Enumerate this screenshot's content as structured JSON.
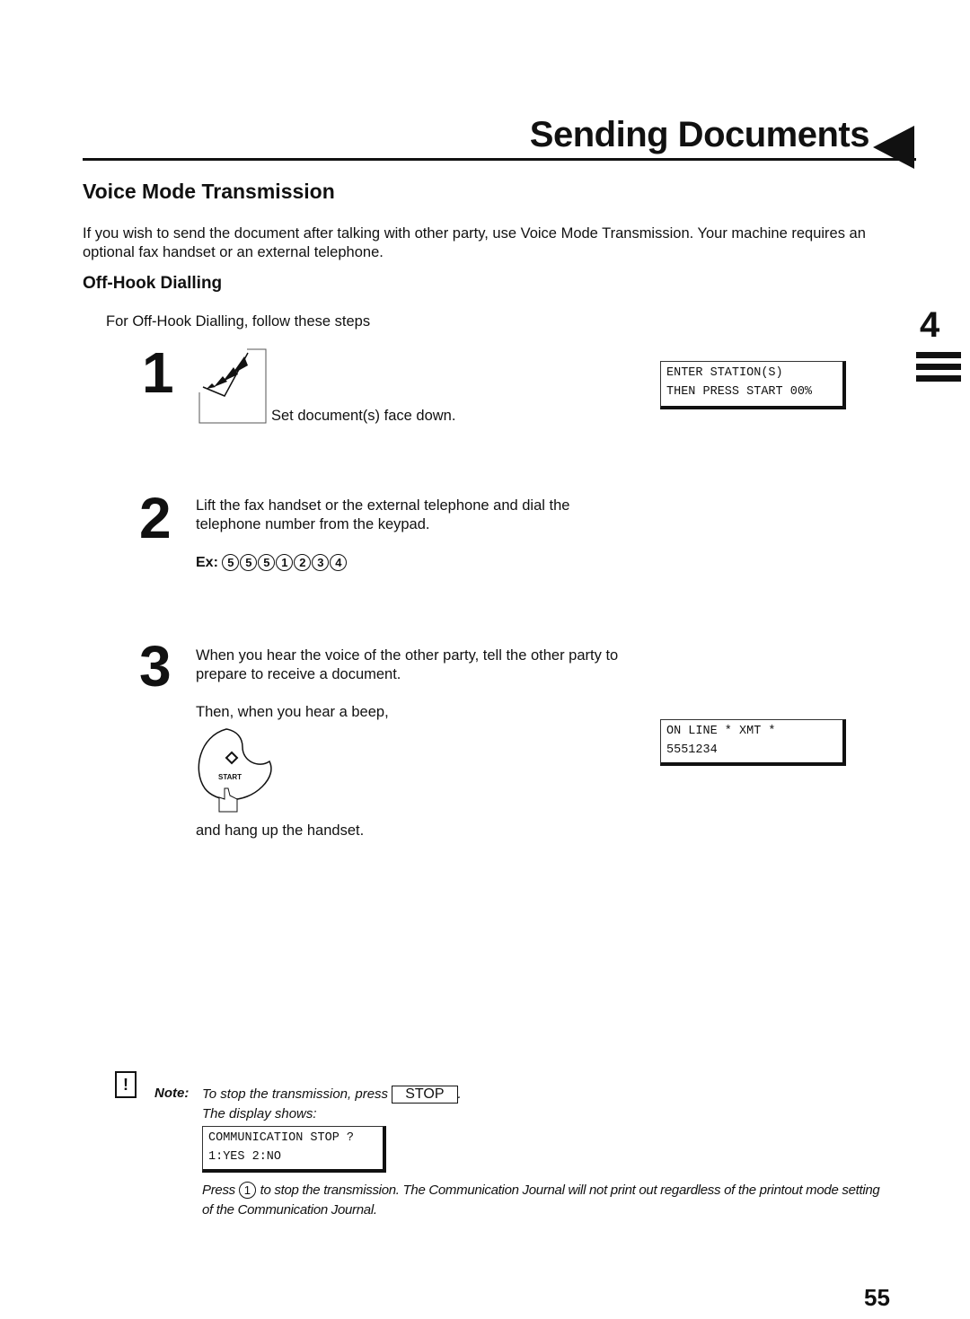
{
  "header": {
    "title": "Sending Documents"
  },
  "chapter": {
    "number": "4"
  },
  "section": {
    "title": "Voice Mode Transmission",
    "intro": "If you wish to send the document after talking with other party, use Voice Mode Transmission. Your machine requires an optional fax handset or an external telephone."
  },
  "subsection": {
    "title": "Off-Hook Dialling",
    "lead": "For Off-Hook Dialling, follow these steps"
  },
  "steps": [
    {
      "number": "1",
      "text": "Set document(s) face down.",
      "display": [
        "ENTER STATION(S)",
        "THEN PRESS START 00%"
      ]
    },
    {
      "number": "2",
      "text": "Lift the fax handset or the external telephone and dial the telephone number from the keypad.",
      "example_label": "Ex:",
      "example_digits": [
        "5",
        "5",
        "5",
        "1",
        "2",
        "3",
        "4"
      ]
    },
    {
      "number": "3",
      "text": "When you hear the voice of the other party, tell the other party to prepare to receive a document.",
      "then": "Then, when you hear a beep,",
      "button_label": "START",
      "after": "and hang up the handset.",
      "display": [
        "ON LINE * XMT *",
        "5551234"
      ]
    }
  ],
  "note": {
    "label": "Note:",
    "line1": "To stop the transmission, press",
    "key": "STOP",
    "line2": "The display shows:",
    "display": [
      "COMMUNICATION STOP ?",
      "1:YES 2:NO"
    ],
    "press": "Press",
    "press_key": "1",
    "press_text": "to stop the transmission. The Communication Journal will not print out regardless of the printout mode setting of the Communication Journal."
  },
  "footer": {
    "page_number": "55"
  }
}
